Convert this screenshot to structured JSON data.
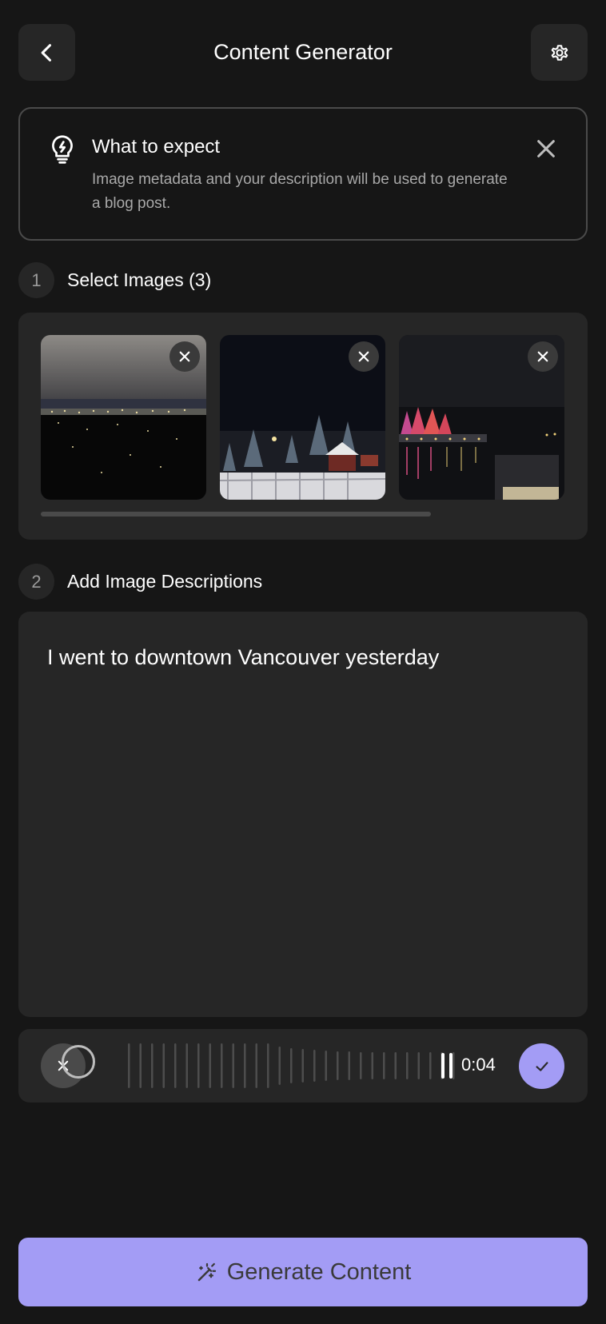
{
  "header": {
    "title": "Content Generator",
    "back_icon": "chevron-left-icon",
    "settings_icon": "gear-icon"
  },
  "info": {
    "title": "What to expect",
    "body": "Image metadata and your description will be used to generate a blog post.",
    "icon": "lightbulb-icon",
    "close_icon": "close-icon"
  },
  "steps": [
    {
      "number": "1",
      "label": "Select Images (3)"
    },
    {
      "number": "2",
      "label": "Add Image Descriptions"
    }
  ],
  "images": [
    {
      "name": "city-view-night",
      "remove_icon": "close-icon"
    },
    {
      "name": "christmas-village-trees",
      "remove_icon": "close-icon"
    },
    {
      "name": "harbour-waterfront-night",
      "remove_icon": "close-icon"
    }
  ],
  "description": {
    "text": "I went to downtown Vancouver yesterday"
  },
  "recorder": {
    "time": "0:04",
    "cancel_icon": "close-icon",
    "confirm_icon": "checkmark-icon"
  },
  "generate": {
    "label": "Generate Content",
    "icon": "magic-wand-icon"
  },
  "colors": {
    "accent": "#a39cf5",
    "background": "#161616",
    "surface": "#262626"
  }
}
